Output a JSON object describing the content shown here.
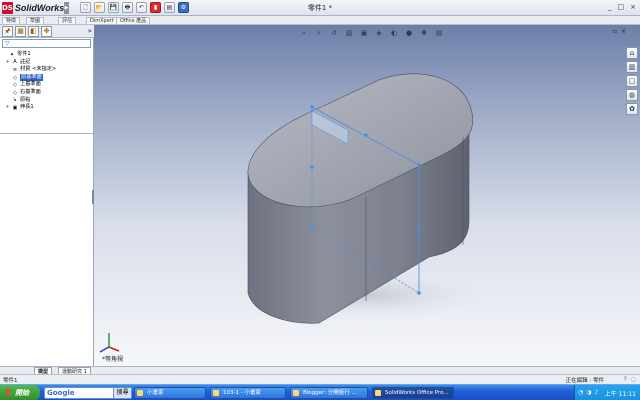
{
  "app": {
    "brand": "SolidWorks",
    "logo_mark": "DS",
    "window_title": "零件1 *",
    "window_controls": [
      "_",
      "□",
      "×"
    ]
  },
  "quick_access": [
    {
      "icon": "new-doc-icon",
      "glyph": "🗋"
    },
    {
      "icon": "open-folder-icon",
      "glyph": "📂"
    },
    {
      "icon": "save-icon",
      "glyph": "💾"
    },
    {
      "icon": "print-icon",
      "glyph": "🖶"
    },
    {
      "icon": "undo-icon",
      "glyph": "↶"
    },
    {
      "icon": "rebuild-icon",
      "glyph": "▮",
      "tone": "red"
    },
    {
      "icon": "file-properties-icon",
      "glyph": "▤"
    },
    {
      "icon": "options-icon",
      "glyph": "⚙",
      "tone": "blue"
    }
  ],
  "command_tabs": [
    "特徵",
    "草圖",
    "評估",
    "DimXpert",
    "Office 產品"
  ],
  "left_panel": {
    "tab_icons": [
      {
        "icon": "feature-manager-icon",
        "glyph": "🖈"
      },
      {
        "icon": "property-manager-icon",
        "glyph": "▦"
      },
      {
        "icon": "configuration-manager-icon",
        "glyph": "◧"
      },
      {
        "icon": "dimxpert-manager-icon",
        "glyph": "✥"
      }
    ],
    "more_glyph": "»",
    "filter_glyph": "▽",
    "tree": [
      {
        "label": "零件1",
        "icon": "part-icon",
        "glyph": "✦",
        "exp": "",
        "indent": 0
      },
      {
        "label": "註記",
        "icon": "annotations-icon",
        "glyph": "A",
        "exp": "+",
        "indent": 1
      },
      {
        "label": "材質 <未指定>",
        "icon": "material-icon",
        "glyph": "≡",
        "exp": "",
        "indent": 1
      },
      {
        "label": "前基準面",
        "icon": "plane-icon",
        "glyph": "◇",
        "exp": "",
        "indent": 1,
        "selected": true
      },
      {
        "label": "上基準面",
        "icon": "plane-icon",
        "glyph": "◇",
        "exp": "",
        "indent": 1
      },
      {
        "label": "右基準面",
        "icon": "plane-icon",
        "glyph": "◇",
        "exp": "",
        "indent": 1
      },
      {
        "label": "原點",
        "icon": "origin-icon",
        "glyph": "↳",
        "exp": "",
        "indent": 1
      },
      {
        "label": "伸長1",
        "icon": "extrude-icon",
        "glyph": "▣",
        "exp": "+",
        "indent": 1
      }
    ]
  },
  "viewport": {
    "toolbar": [
      {
        "icon": "zoom-to-fit-icon",
        "glyph": "⌕"
      },
      {
        "icon": "zoom-to-area-icon",
        "glyph": "⌕"
      },
      {
        "icon": "previous-view-icon",
        "glyph": "↺"
      },
      {
        "icon": "section-view-icon",
        "glyph": "▥"
      },
      {
        "icon": "view-orientation-icon",
        "glyph": "▣"
      },
      {
        "icon": "display-style-icon",
        "glyph": "◈"
      },
      {
        "icon": "hide-show-items-icon",
        "glyph": "◐"
      },
      {
        "icon": "edit-appearance-icon",
        "glyph": "●"
      },
      {
        "icon": "apply-scene-icon",
        "glyph": "✺"
      },
      {
        "icon": "view-settings-icon",
        "glyph": "▤"
      }
    ],
    "pane_controls": [
      "▫",
      "×"
    ],
    "task_pane": [
      {
        "icon": "home-icon",
        "glyph": "⌂"
      },
      {
        "icon": "design-library-icon",
        "glyph": "▥"
      },
      {
        "icon": "file-explorer-icon",
        "glyph": "▢"
      },
      {
        "icon": "view-palette-icon",
        "glyph": "◍"
      },
      {
        "icon": "appearances-icon",
        "glyph": "✿"
      }
    ],
    "view_label": "*等角視",
    "colors": {
      "body": "#8a8e9b",
      "top_face": "#a8abb6",
      "sketch": "#4a90e2"
    }
  },
  "bottom_tabs": [
    "模型",
    "運動研究 1"
  ],
  "status": {
    "left": "零件1",
    "editing": "正在編輯 : 零件",
    "icons": [
      "?",
      "◌"
    ]
  },
  "taskbar": {
    "start": "開始",
    "search_brand": "Google",
    "search_button": "搜尋",
    "tasks": [
      {
        "label": "小畫家",
        "active": false
      },
      {
        "label": "103-1 - 小畫家",
        "active": false
      },
      {
        "label": "Blogger: 分開旋行 ...",
        "active": false
      },
      {
        "label": "SolidWorks Office Pro...",
        "active": true
      }
    ],
    "tray_icons": [
      "◔",
      "◑",
      "♪"
    ],
    "clock": "上午 11:11"
  }
}
